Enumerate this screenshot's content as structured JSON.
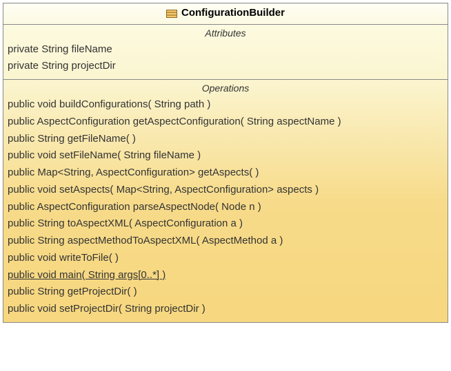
{
  "className": "ConfigurationBuilder",
  "labels": {
    "attributes": "Attributes",
    "operations": "Operations"
  },
  "attributes": [
    {
      "text": "private String fileName",
      "static": false
    },
    {
      "text": "private String projectDir",
      "static": false
    }
  ],
  "operations": [
    {
      "text": "public void  buildConfigurations( String path )",
      "static": false
    },
    {
      "text": "public AspectConfiguration  getAspectConfiguration( String aspectName )",
      "static": false
    },
    {
      "text": "public String  getFileName(  )",
      "static": false
    },
    {
      "text": "public void  setFileName( String fileName )",
      "static": false
    },
    {
      "text": "public Map<String, AspectConfiguration>  getAspects(  )",
      "static": false
    },
    {
      "text": "public void  setAspects( Map<String, AspectConfiguration> aspects )",
      "static": false
    },
    {
      "text": "public AspectConfiguration  parseAspectNode( Node n )",
      "static": false
    },
    {
      "text": "public String  toAspectXML( AspectConfiguration a )",
      "static": false
    },
    {
      "text": "public String  aspectMethodToAspectXML( AspectMethod a )",
      "static": false
    },
    {
      "text": "public void  writeToFile(  )",
      "static": false
    },
    {
      "text": "public void  main( String args[0..*] )",
      "static": true
    },
    {
      "text": "public String  getProjectDir(  )",
      "static": false
    },
    {
      "text": "public void  setProjectDir( String projectDir )",
      "static": false
    }
  ]
}
